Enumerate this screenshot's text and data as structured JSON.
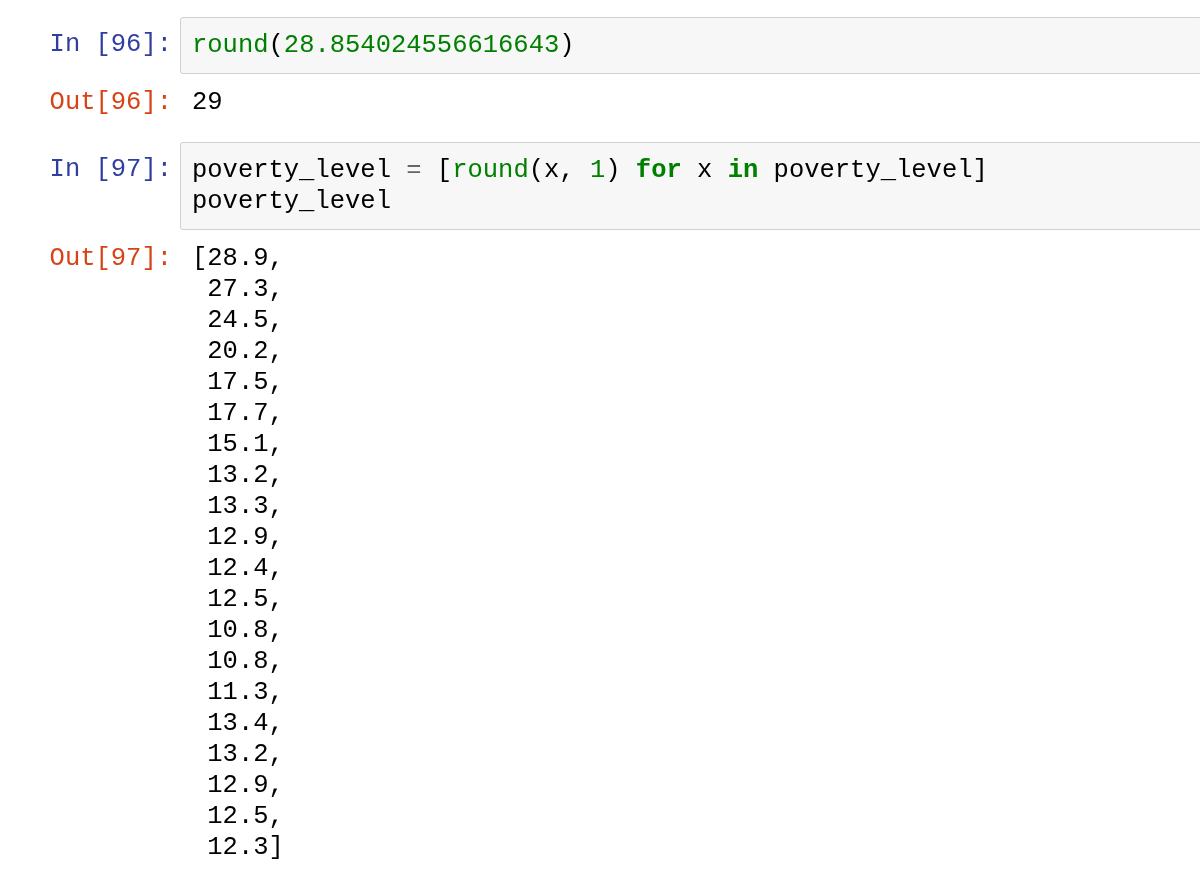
{
  "cells": [
    {
      "kind": "input",
      "prompt": "In [96]:",
      "lines": [
        [
          {
            "kind": "builtin",
            "text": "round"
          },
          {
            "kind": "plain",
            "text": "("
          },
          {
            "kind": "number",
            "text": "28.854024556616643"
          },
          {
            "kind": "plain",
            "text": ")"
          }
        ]
      ]
    },
    {
      "kind": "output",
      "prompt": "Out[96]:",
      "lines": [
        "29"
      ]
    },
    {
      "kind": "input",
      "prompt": "In [97]:",
      "lines": [
        [
          {
            "kind": "plain",
            "text": "poverty_level "
          },
          {
            "kind": "operator",
            "text": "="
          },
          {
            "kind": "plain",
            "text": " ["
          },
          {
            "kind": "builtin",
            "text": "round"
          },
          {
            "kind": "plain",
            "text": "(x, "
          },
          {
            "kind": "number",
            "text": "1"
          },
          {
            "kind": "plain",
            "text": ") "
          },
          {
            "kind": "keyword",
            "text": "for"
          },
          {
            "kind": "plain",
            "text": " x "
          },
          {
            "kind": "keyword",
            "text": "in"
          },
          {
            "kind": "plain",
            "text": " poverty_level]"
          }
        ],
        [
          {
            "kind": "plain",
            "text": "poverty_level"
          }
        ]
      ]
    },
    {
      "kind": "output",
      "prompt": "Out[97]:",
      "lines": [
        "[28.9,",
        " 27.3,",
        " 24.5,",
        " 20.2,",
        " 17.5,",
        " 17.7,",
        " 15.1,",
        " 13.2,",
        " 13.3,",
        " 12.9,",
        " 12.4,",
        " 12.5,",
        " 10.8,",
        " 10.8,",
        " 11.3,",
        " 13.4,",
        " 13.2,",
        " 12.9,",
        " 12.5,",
        " 12.3]"
      ]
    }
  ]
}
